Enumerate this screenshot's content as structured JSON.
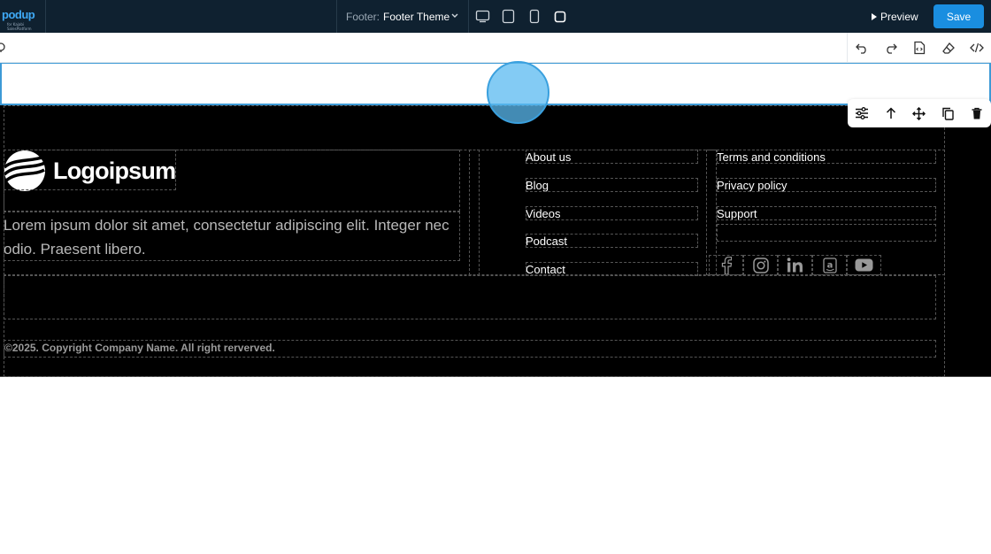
{
  "topbar": {
    "logo_text": "podup",
    "logo_subtext": "for Kajabi SalesPlatform",
    "footer_label": "Footer:",
    "footer_value": "Footer Theme",
    "preview_label": "Preview",
    "save_label": "Save"
  },
  "footer": {
    "brand_name": "Logoipsum",
    "description": "Lorem ipsum dolor sit amet, consectetur adipiscing elit. Integer nec odio. Praesent libero.",
    "links_col1": [
      "About us",
      "Blog",
      "Videos",
      "Podcast",
      "Contact"
    ],
    "links_col2": [
      "Terms and conditions",
      "Privacy policy",
      "Support"
    ],
    "social_icons": [
      "facebook-icon",
      "instagram-icon",
      "linkedin-icon",
      "amazon-icon",
      "youtube-icon"
    ],
    "copyright": "©2025. Copyright Company Name. All right rerverved."
  },
  "colors": {
    "topbar_bg": "#0f2130",
    "accent": "#1a8ee0",
    "footer_bg": "#000000",
    "selection": "#3d9ad6"
  }
}
